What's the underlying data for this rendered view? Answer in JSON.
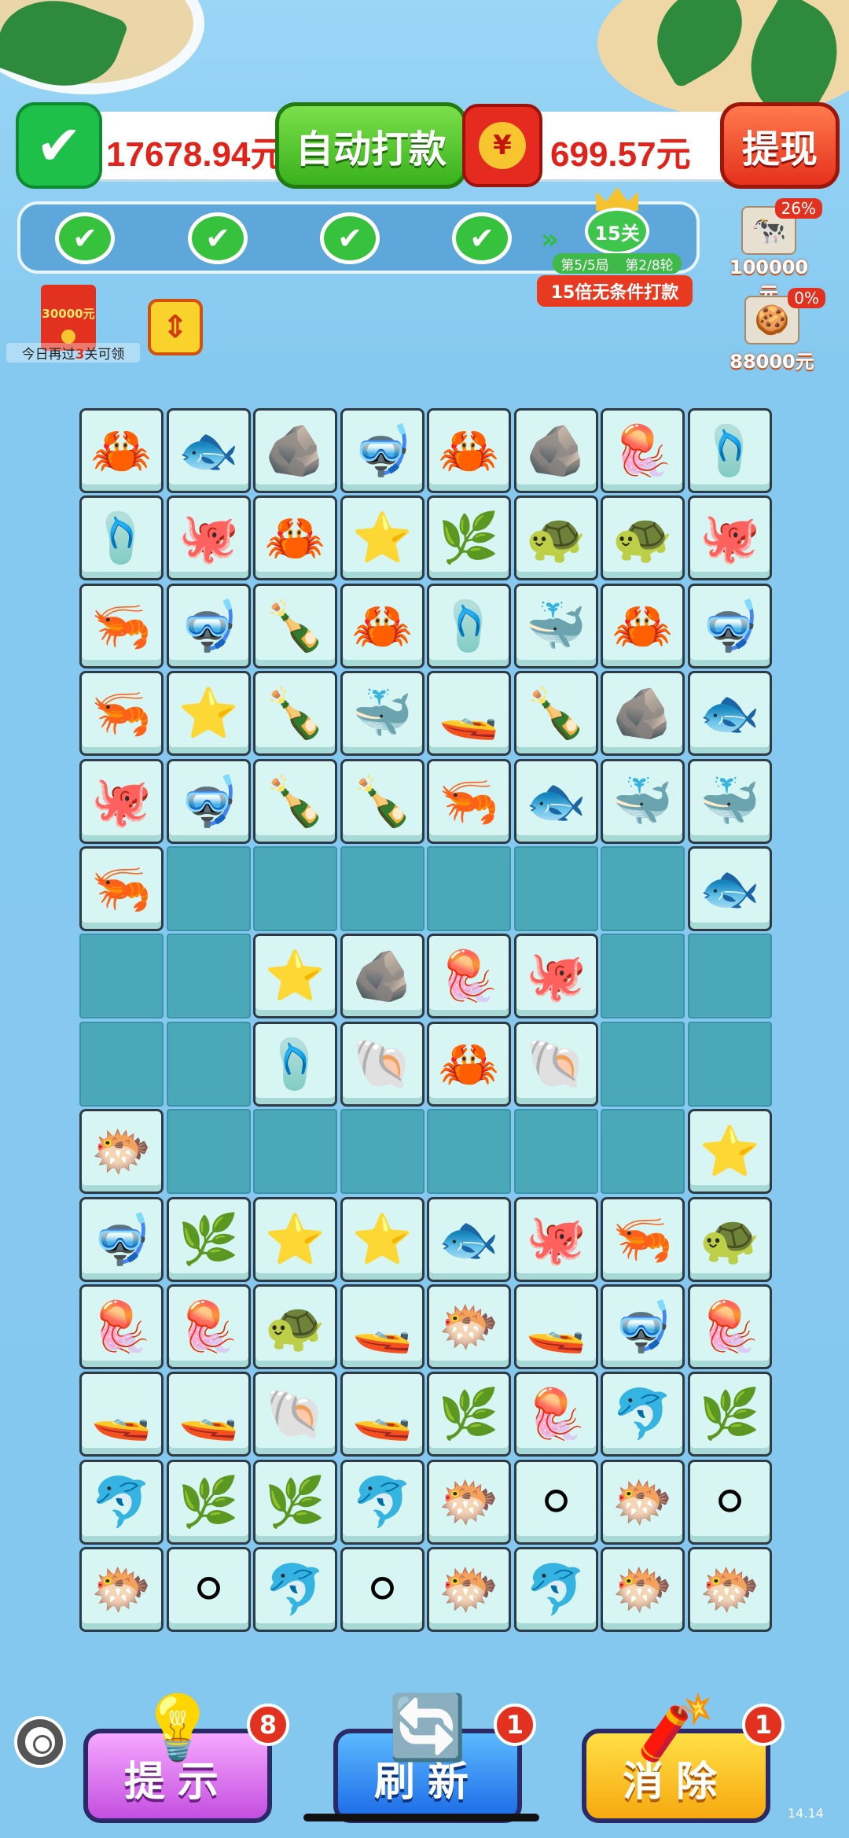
{
  "wallet": {
    "wechat_amount": "17678.94元",
    "auto_pay_label": "自动打款",
    "cash_amount": "699.57元",
    "withdraw_label": "提现",
    "coin_symbol": "¥"
  },
  "progress": {
    "completed_marks": [
      "✔",
      "✔",
      "✔",
      "✔"
    ],
    "next_arrows": "»",
    "level_label": "15关",
    "round_game": "第5/5局",
    "round_turn": "第2/8轮",
    "banner": "15倍无条件打款"
  },
  "rankings": [
    {
      "percent": "26%",
      "prize": "100000元",
      "avatar": "cow-avatar"
    },
    {
      "percent": "0%",
      "prize": "88000元",
      "avatar": "gingerbread-avatar"
    }
  ],
  "red_envelope": {
    "amount": "30000元",
    "caption_prefix": "今日再过",
    "caption_count": "3",
    "caption_suffix": "关可领"
  },
  "board": {
    "columns": 8,
    "rows": 14,
    "legend": {
      "crab": "🦀",
      "ray": "🐟",
      "rock": "🪨",
      "goggles": "🤿",
      "jellyfish": "🪼",
      "flipper": "🩴",
      "octopus": "🐙",
      "starfish": "⭐",
      "seaweed": "🌿",
      "turtle": "🐢",
      "shrimp": "🦐",
      "bottle": "🍾",
      "whale": "🐳",
      "submarine": "🚤",
      "shell": "🐚",
      "puffer": "🐡",
      "pearl": "⚪",
      "dolphin": "🐬"
    },
    "grid": [
      [
        "crab",
        "ray",
        "rock",
        "goggles",
        "crab",
        "rock",
        "jellyfish",
        "flipper"
      ],
      [
        "flipper",
        "octopus",
        "crab",
        "starfish",
        "seaweed",
        "turtle",
        "turtle",
        "octopus"
      ],
      [
        "shrimp",
        "goggles",
        "bottle",
        "crab",
        "flipper",
        "whale",
        "crab",
        "goggles"
      ],
      [
        "shrimp",
        "starfish",
        "bottle",
        "whale",
        "submarine",
        "bottle",
        "rock",
        "ray"
      ],
      [
        "octopus",
        "goggles",
        "bottle",
        "bottle",
        "shrimp",
        "ray",
        "whale",
        "whale"
      ],
      [
        "shrimp",
        null,
        null,
        null,
        null,
        null,
        null,
        "ray"
      ],
      [
        null,
        null,
        "starfish",
        "rock",
        "jellyfish",
        "octopus",
        null,
        null
      ],
      [
        null,
        null,
        "flipper",
        "shell",
        "crab",
        "shell",
        null,
        null
      ],
      [
        "puffer",
        null,
        null,
        null,
        null,
        null,
        null,
        "starfish"
      ],
      [
        "goggles",
        "seaweed",
        "starfish",
        "starfish",
        "ray",
        "octopus",
        "shrimp",
        "turtle"
      ],
      [
        "jellyfish",
        "jellyfish",
        "turtle",
        "submarine",
        "puffer",
        "submarine",
        "goggles",
        "jellyfish"
      ],
      [
        "submarine",
        "submarine",
        "shell",
        "submarine",
        "seaweed",
        "jellyfish",
        "dolphin",
        "seaweed"
      ],
      [
        "dolphin",
        "seaweed",
        "seaweed",
        "dolphin",
        "puffer",
        "pearl",
        "puffer",
        "pearl"
      ],
      [
        "puffer",
        "pearl",
        "dolphin",
        "pearl",
        "puffer",
        "dolphin",
        "puffer",
        "puffer"
      ]
    ]
  },
  "tools": {
    "hint_label": "提示",
    "hint_count": "8",
    "refresh_label": "刷新",
    "refresh_count": "1",
    "remove_label": "消除",
    "remove_count": "1"
  },
  "version": "14.14"
}
